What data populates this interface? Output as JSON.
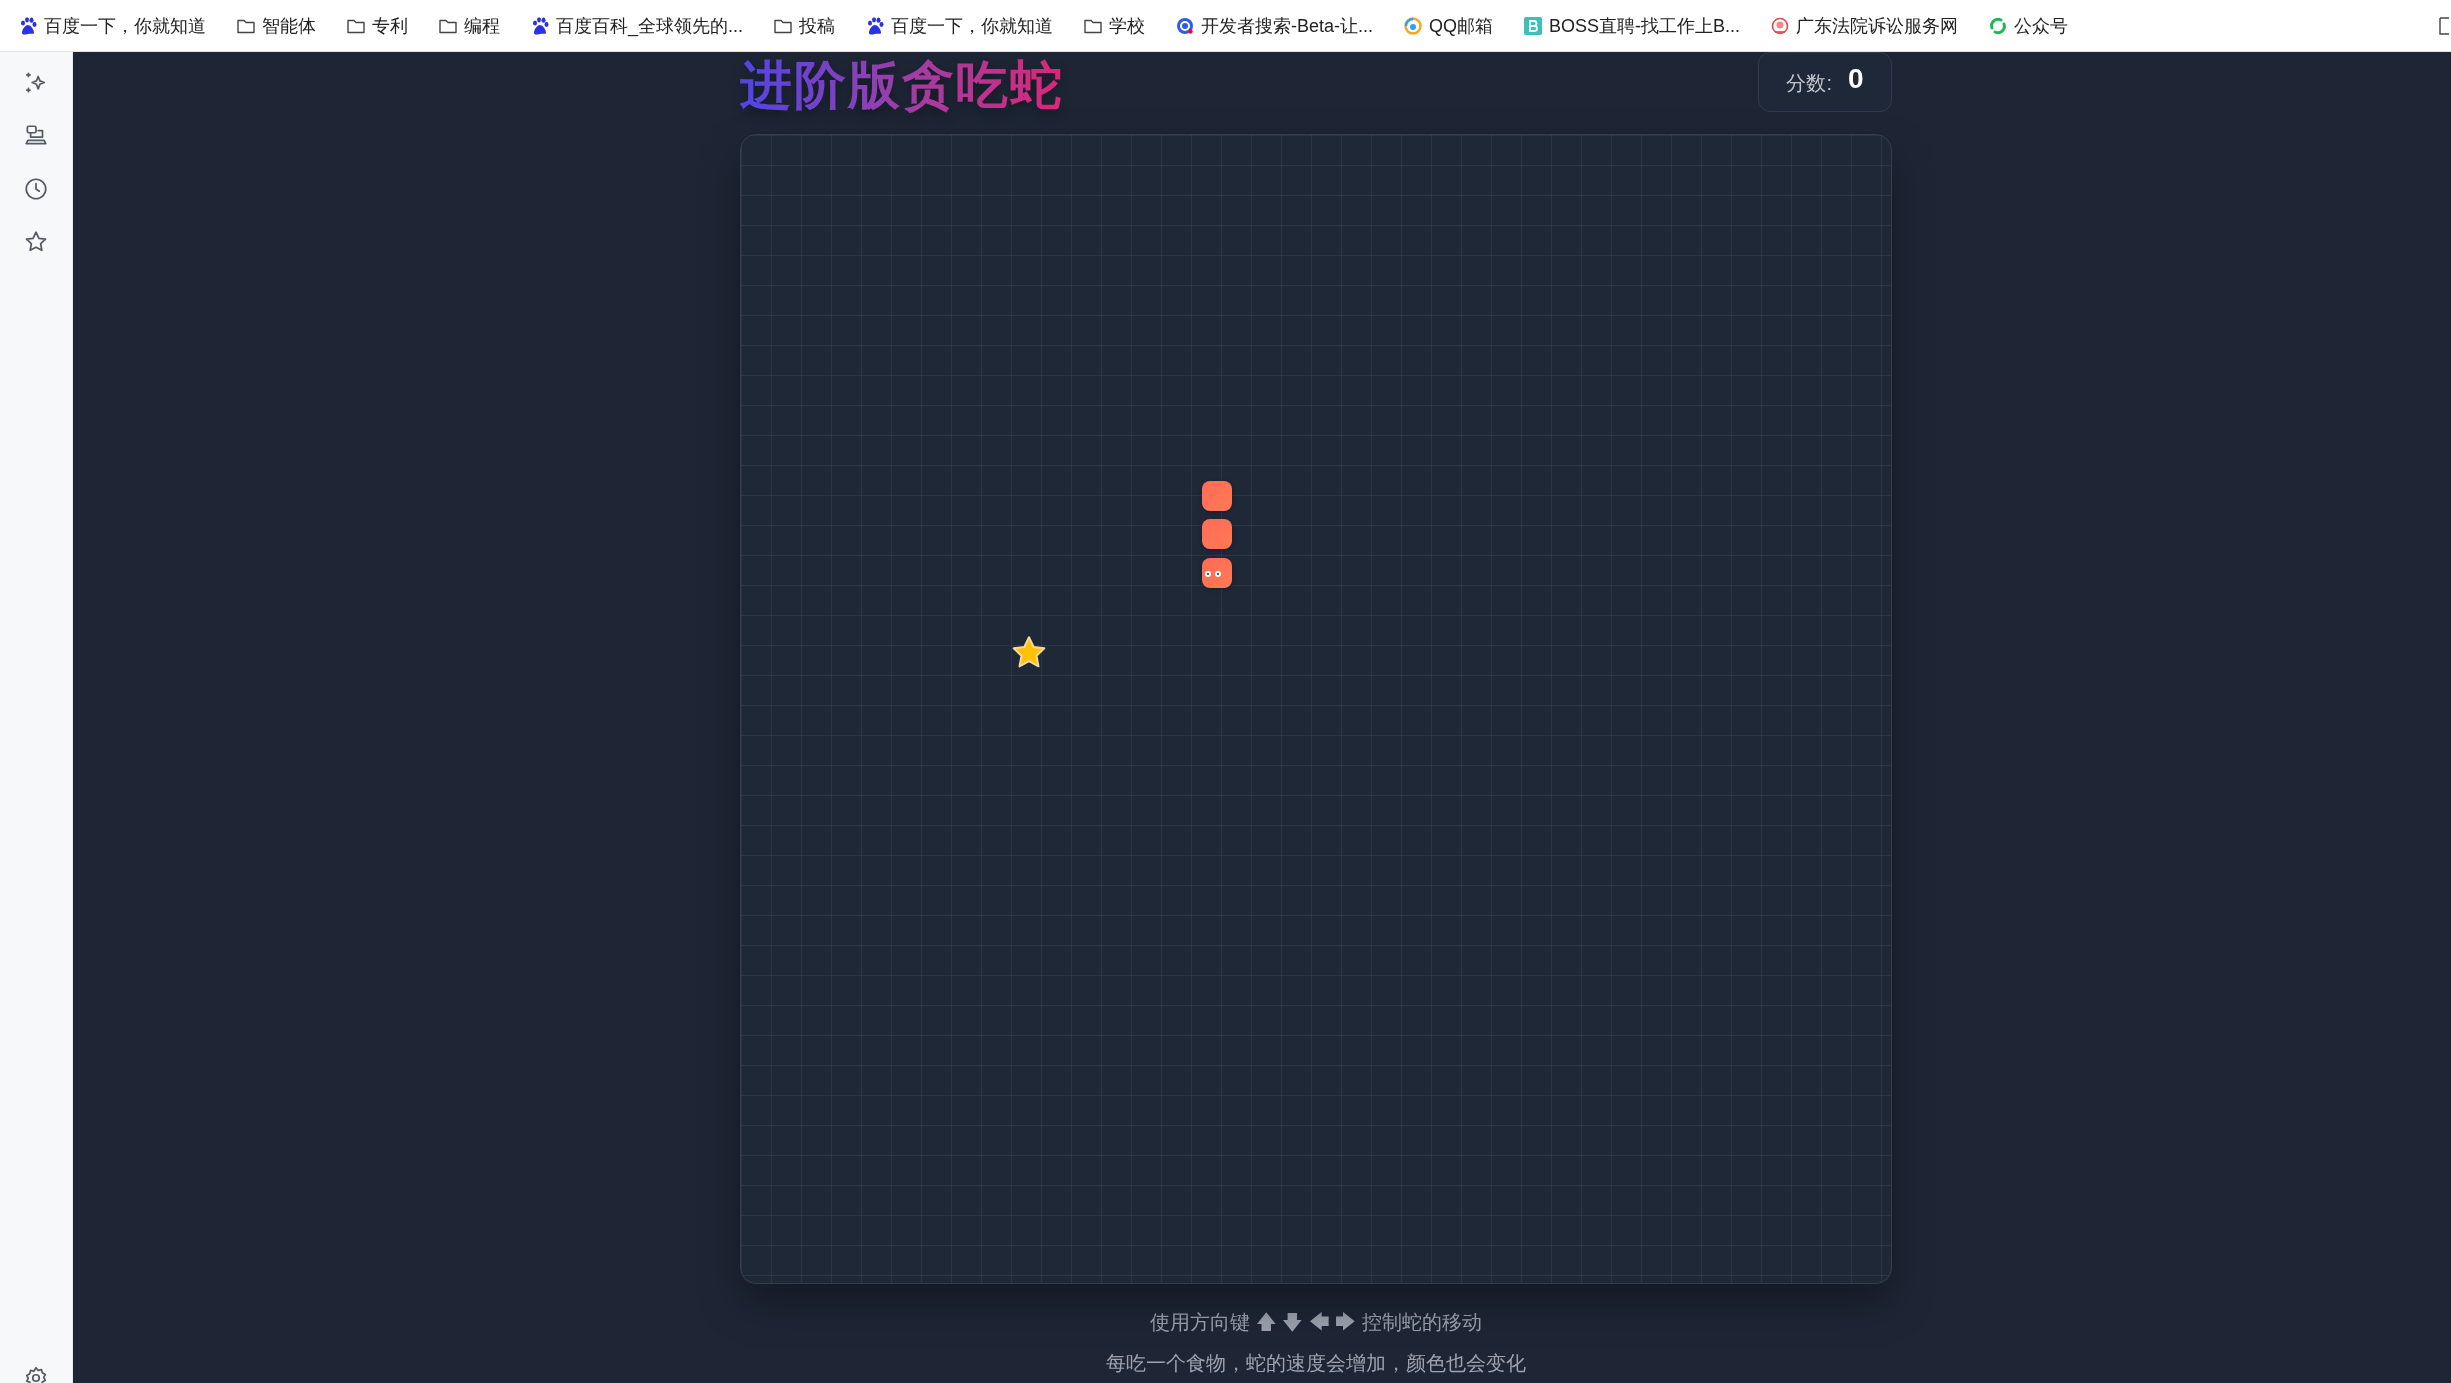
{
  "bookmarks": [
    {
      "kind": "paw",
      "label": "百度一下，你就知道"
    },
    {
      "kind": "folder",
      "label": "智能体"
    },
    {
      "kind": "folder",
      "label": "专利"
    },
    {
      "kind": "folder",
      "label": "编程"
    },
    {
      "kind": "paw",
      "label": "百度百科_全球领先的..."
    },
    {
      "kind": "folder",
      "label": "投稿"
    },
    {
      "kind": "paw",
      "label": "百度一下，你就知道"
    },
    {
      "kind": "folder",
      "label": "学校"
    },
    {
      "kind": "search",
      "label": "开发者搜索-Beta-让..."
    },
    {
      "kind": "mail",
      "label": "QQ邮箱"
    },
    {
      "kind": "letter",
      "label": "BOSS直聘-找工作上B..."
    },
    {
      "kind": "emblem",
      "label": "广东法院诉讼服务网"
    },
    {
      "kind": "swirl",
      "label": "公众号"
    }
  ],
  "sidebar": {
    "items": [
      {
        "kind": "sparkle"
      },
      {
        "kind": "devices"
      },
      {
        "kind": "clock"
      },
      {
        "kind": "star"
      }
    ],
    "bottom": [
      {
        "kind": "gear"
      }
    ]
  },
  "game": {
    "title": "进阶版贪吃蛇",
    "score_label": "分数:",
    "score": "0",
    "snake": [
      {
        "kind": "body"
      },
      {
        "kind": "body"
      },
      {
        "kind": "head"
      }
    ],
    "food": {
      "kind": "star"
    }
  },
  "instructions": [
    "使用方向键 🡅 🡇 🡄 🡆 控制蛇的移动",
    "每吃一个食物，蛇的速度会增加，颜色也会变化"
  ]
}
